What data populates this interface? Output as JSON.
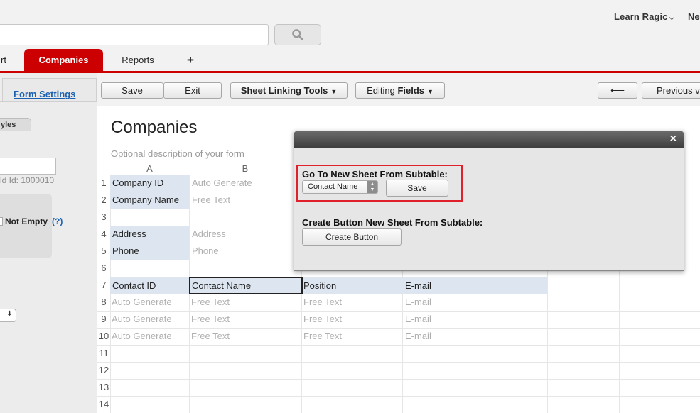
{
  "header": {
    "learn_label": "Learn Ragic",
    "new_label_cut": "Ne"
  },
  "tabs": {
    "prev_cut": "rt",
    "active": "Companies",
    "reports": "Reports",
    "add": "+"
  },
  "left_panel": {
    "form_settings": "Form Settings",
    "styles_tab": "yles",
    "field_id_text": "ld Id: 1000010",
    "not_empty": "Not Empty",
    "help": "(?)"
  },
  "toolbar": {
    "save": "Save",
    "exit": "Exit",
    "sheet_linking": "Sheet Linking Tools",
    "editing_prefix": "Editing ",
    "editing_bold": "Fields",
    "back_arrow": "⟵",
    "previous_version": "Previous ve"
  },
  "sheet": {
    "title": "Companies",
    "description": "Optional description of your form",
    "columns": [
      "A",
      "B"
    ],
    "row_numbers": [
      "1",
      "2",
      "3",
      "4",
      "5",
      "6",
      "7",
      "8",
      "9",
      "10",
      "11",
      "12",
      "13",
      "14"
    ],
    "fields": {
      "company_id": "Company ID",
      "company_id_ph": "Auto Generate",
      "company_name": "Company Name",
      "company_name_ph": "Free Text",
      "address": "Address",
      "address_ph": "Address",
      "phone": "Phone",
      "phone_ph": "Phone"
    },
    "subtable": {
      "headers": [
        "Contact ID",
        "Contact Name",
        "Position",
        "E-mail"
      ],
      "rows": [
        [
          "Auto Generate",
          "Free Text",
          "Free Text",
          "E-mail"
        ],
        [
          "Auto Generate",
          "Free Text",
          "Free Text",
          "E-mail"
        ],
        [
          "Auto Generate",
          "Free Text",
          "Free Text",
          "E-mail"
        ]
      ]
    }
  },
  "modal": {
    "close": "×",
    "goto_label": "Go To New Sheet From Subtable:",
    "goto_selected": "Contact Name",
    "save": "Save",
    "create_label": "Create Button New Sheet From Subtable:",
    "create_button": "Create Button"
  },
  "colors": {
    "accent_red": "#cc0000",
    "link_blue": "#1d62b0",
    "label_cell_bg": "#dde6f0",
    "highlight_red": "#e0202a"
  }
}
